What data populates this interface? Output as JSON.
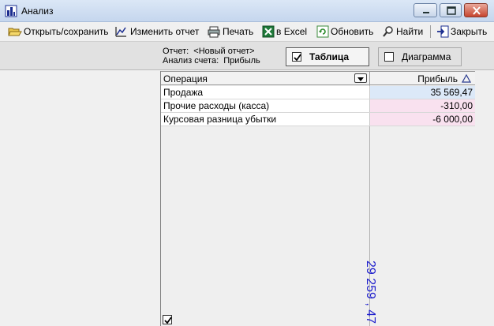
{
  "window": {
    "title": "Анализ"
  },
  "toolbar": {
    "open_save": "Открыть/сохранить",
    "edit_report": "Изменить отчет",
    "print": "Печать",
    "excel": "в Excel",
    "refresh": "Обновить",
    "find": "Найти",
    "close": "Закрыть"
  },
  "info": {
    "report_label": "Отчет:",
    "report_value": "<Новый отчет>",
    "account_label": "Анализ счета:",
    "account_value": "Прибыль"
  },
  "view_toggle": {
    "table_label": "Таблица",
    "table_checked": true,
    "chart_label": "Диаграмма",
    "chart_checked": false
  },
  "grid": {
    "columns": [
      "Операция",
      "Прибыль"
    ],
    "rows": [
      {
        "operation": "Продажа",
        "profit": "35 569,47",
        "sign": "positive"
      },
      {
        "operation": "Прочие расходы (касса)",
        "profit": "-310,00",
        "sign": "negative"
      },
      {
        "operation": "Курсовая разница убытки",
        "profit": "-6 000,00",
        "sign": "negative"
      }
    ],
    "total": "29 259 , 47"
  },
  "colors": {
    "positive_cell": "#dce9f8",
    "negative_cell": "#f9e1ef",
    "total_text": "#1d1dcc"
  }
}
